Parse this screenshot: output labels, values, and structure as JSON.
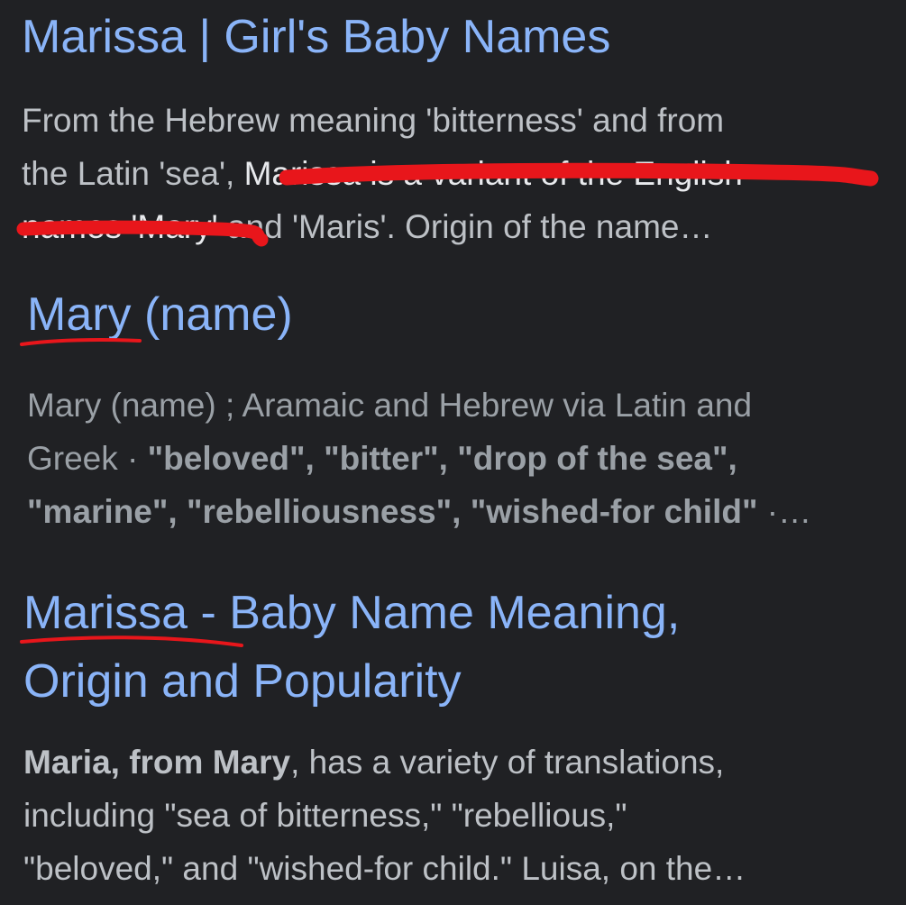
{
  "results": [
    {
      "title": "Marissa | Girl's Baby Names",
      "snippet": {
        "l1": "From the Hebrew meaning 'bitterness' and from",
        "l2a": "the Latin 'sea', ",
        "l2b": "Marissa is a variant of the English",
        "l3a": "names 'Mary'",
        "l3b": " and 'Maris'. Origin of the name…"
      }
    },
    {
      "title_a": "Mary",
      "title_b": " (name)",
      "snippet": {
        "l1": "Mary (name) ; Aramaic and Hebrew via Latin and",
        "l2a": "Greek · ",
        "l2b": "\"beloved\", \"bitter\", \"drop of the sea\",",
        "l3a": "\"marine\", \"rebelliousness\", \"wished-for child\"",
        "l3b": " ·…"
      }
    },
    {
      "title_line1a": "Marissa",
      "title_line1b": " - Baby Name Meaning,",
      "title_line2": "Origin and Popularity",
      "snippet": {
        "l1a": "Maria, from Mary",
        "l1b": ", has a variety of translations,",
        "l2": "including \"sea of bitterness,\" \"rebellious,\"",
        "l3": "\"beloved,\" and \"wished-for child.\" Luisa, on the…"
      }
    }
  ],
  "colors": {
    "background": "#202124",
    "link": "#8ab4f8",
    "snippet_text": "#bdc1c6",
    "annotation_red": "#e8161b"
  }
}
